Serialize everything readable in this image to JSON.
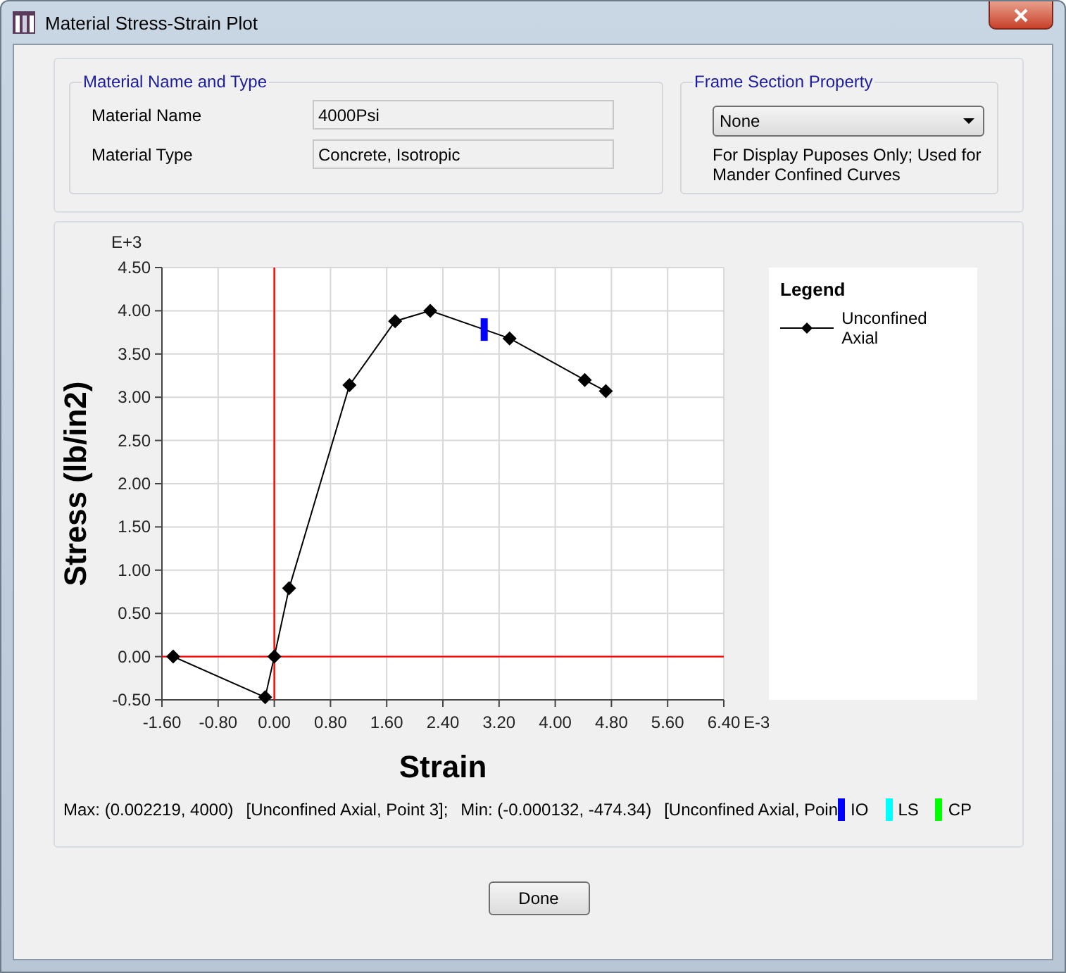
{
  "window": {
    "title": "Material Stress-Strain Plot"
  },
  "material_group": {
    "title": "Material Name and Type",
    "fields": [
      {
        "label": "Material Name",
        "value": "4000Psi"
      },
      {
        "label": "Material Type",
        "value": "Concrete, Isotropic"
      }
    ]
  },
  "frame_section_group": {
    "title": "Frame Section Property",
    "dropdown": {
      "value": "None"
    },
    "note": "For Display Puposes Only;  Used for Mander Confined Curves"
  },
  "plot": {
    "x_multiplier": "E-3",
    "y_multiplier": "E+3",
    "chart_data": {
      "type": "line",
      "xlabel": "Strain",
      "ylabel": "Stress (lb/in2)",
      "grid": true,
      "xlim": [
        -1.6,
        6.4
      ],
      "ylim": [
        -0.5,
        4.5
      ],
      "xticks": [
        {
          "value": -1.6,
          "label": "-1.60"
        },
        {
          "value": -0.8,
          "label": "-0.80"
        },
        {
          "value": 0,
          "label": "0.00"
        },
        {
          "value": 0.8,
          "label": "0.80"
        },
        {
          "value": 1.6,
          "label": "1.60"
        },
        {
          "value": 2.4,
          "label": "2.40"
        },
        {
          "value": 3.2,
          "label": "3.20"
        },
        {
          "value": 4,
          "label": "4.00"
        },
        {
          "value": 4.8,
          "label": "4.80"
        },
        {
          "value": 5.6,
          "label": "5.60"
        },
        {
          "value": 6.4,
          "label": "6.40"
        }
      ],
      "yticks": [
        {
          "value": -0.5,
          "label": "-0.50"
        },
        {
          "value": 0,
          "label": "0.00"
        },
        {
          "value": 0.5,
          "label": "0.50"
        },
        {
          "value": 1,
          "label": "1.00"
        },
        {
          "value": 1.5,
          "label": "1.50"
        },
        {
          "value": 2,
          "label": "2.00"
        },
        {
          "value": 2.5,
          "label": "2.50"
        },
        {
          "value": 3,
          "label": "3.00"
        },
        {
          "value": 3.5,
          "label": "3.50"
        },
        {
          "value": 4,
          "label": "4.00"
        },
        {
          "value": 4.5,
          "label": "4.50"
        }
      ],
      "x": [
        -1.44,
        -0.13,
        0,
        0.21,
        1.07,
        1.72,
        2.22,
        3.35,
        4.42,
        4.72
      ],
      "series": [
        {
          "name": "Unconfined Axial",
          "color": "#000000",
          "marker": "diamond",
          "values": [
            0,
            -0.47,
            0,
            0.79,
            3.14,
            3.88,
            4.0,
            3.68,
            3.2,
            3.07
          ]
        }
      ]
    },
    "legend": {
      "title": "Legend"
    }
  },
  "status": {
    "parts": [
      "Max: (0.002219, 4000)",
      "[Unconfined Axial, Point 3];",
      "Min: (-0.000132, -474.34)",
      "[Unconfined Axial, Poin"
    ],
    "levels": [
      {
        "label": "IO",
        "color": "#0000ff"
      },
      {
        "label": "LS",
        "color": "#00ffff"
      },
      {
        "label": "CP",
        "color": "#00ff00"
      }
    ]
  },
  "buttons": [
    "Done"
  ]
}
